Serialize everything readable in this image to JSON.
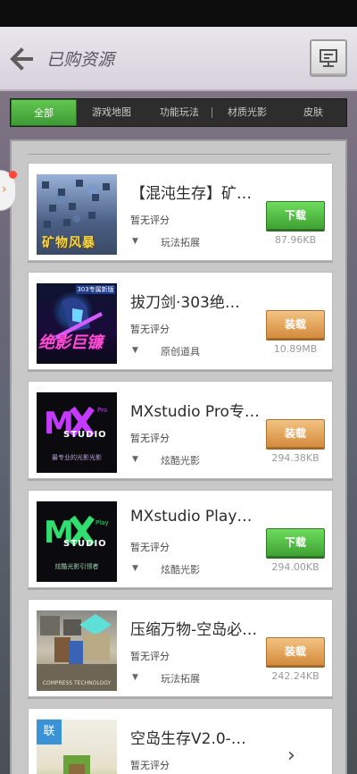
{
  "header": {
    "title": "已购资源"
  },
  "tabs": [
    "全部",
    "游戏地图",
    "功能玩法",
    "材质光影",
    "皮肤"
  ],
  "items": [
    {
      "title": "【混沌生存】矿…",
      "rating": "暂无评分",
      "category": "玩法拓展",
      "button": "下载",
      "size": "87.96KB",
      "thumb_text": "矿物风暴"
    },
    {
      "title": "拔刀剑·303绝…",
      "rating": "暂无评分",
      "category": "原创道具",
      "button": "装载",
      "size": "10.89MB",
      "thumb_text": "绝影巨镰",
      "thumb_top": "303专属新版"
    },
    {
      "title": "MXstudio Pro专…",
      "rating": "暂无评分",
      "category": "炫酷光影",
      "button": "装载",
      "size": "294.38KB",
      "thumb_text": "STUDIO",
      "thumb_sub": "最专业的光影光影"
    },
    {
      "title": "MXstudio Play…",
      "rating": "暂无评分",
      "category": "炫酷光影",
      "button": "下载",
      "size": "294.00KB",
      "thumb_text": "STUDIO",
      "thumb_sub": "炫酷光影引领者"
    },
    {
      "title": "压缩万物-空岛必…",
      "rating": "暂无评分",
      "category": "玩法拓展",
      "button": "装载",
      "size": "242.24KB",
      "thumb_text": "COMPRESS TECHNOLOGY"
    },
    {
      "title": "空岛生存V2.0-…",
      "rating": "暂无评分",
      "badge": "联"
    }
  ],
  "colors": {
    "green": "#4cb83f",
    "orange": "#e39a4b",
    "header_bg": "#e0dce4"
  }
}
